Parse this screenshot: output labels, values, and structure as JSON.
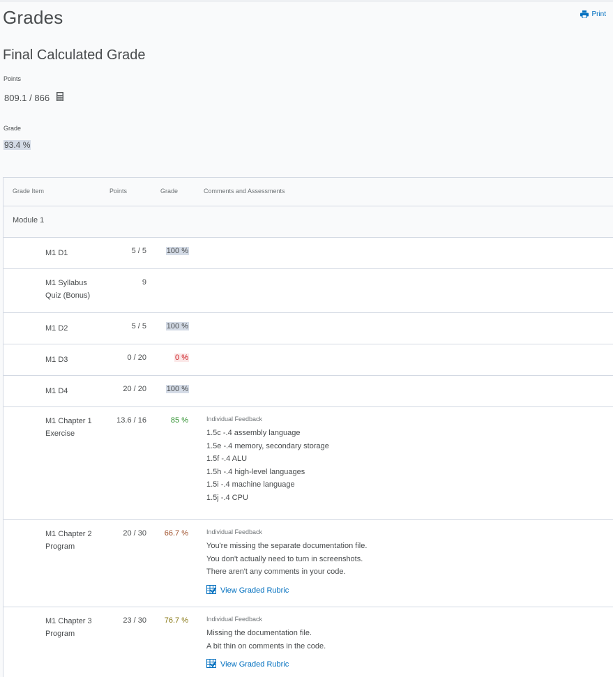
{
  "page": {
    "title": "Grades",
    "print_label": "Print"
  },
  "final": {
    "title": "Final Calculated Grade",
    "points_label": "Points",
    "points_value": "809.1 / 866",
    "grade_label": "Grade",
    "grade_value": "93.4 %"
  },
  "table": {
    "headers": {
      "item": "Grade Item",
      "points": "Points",
      "grade": "Grade",
      "comments": "Comments and Assessments"
    },
    "category": "Module 1",
    "rows": [
      {
        "name": "M1 D1",
        "points": "5 / 5",
        "grade": "100 %"
      },
      {
        "name": "M1 Syllabus Quiz (Bonus)",
        "points": "9",
        "grade": ""
      },
      {
        "name": "M1 D2",
        "points": "5 / 5",
        "grade": "100 %"
      },
      {
        "name": "M1 D3",
        "points": "0 / 20",
        "grade": "0 %"
      },
      {
        "name": "M1 D4",
        "points": "20 / 20",
        "grade": "100 %"
      },
      {
        "name": "M1 Chapter 1 Exercise",
        "points": "13.6 / 16",
        "grade": "85 %",
        "feedback_label": "Individual Feedback",
        "feedback": [
          "1.5c -.4 assembly language",
          "1.5e -.4 memory, secondary storage",
          "1.5f -.4 ALU",
          "1.5h -.4 high-level languages",
          "1.5i -.4 machine language",
          "1.5j -.4 CPU"
        ]
      },
      {
        "name": "M1 Chapter 2 Program",
        "points": "20 / 30",
        "grade": "66.7 %",
        "feedback_label": "Individual Feedback",
        "feedback": [
          "You're missing the separate documentation file.",
          "You don't actually need to turn in screenshots.",
          "There aren't any comments in your code."
        ],
        "rubric_link": "View Graded Rubric"
      },
      {
        "name": "M1 Chapter 3 Program",
        "points": "23 / 30",
        "grade": "76.7 %",
        "feedback_label": "Individual Feedback",
        "feedback": [
          "Missing the documentation file.",
          "A bit thin on comments in the code."
        ],
        "rubric_link": "View Graded Rubric"
      }
    ]
  },
  "colors": {
    "accent_link": "#006fbf",
    "grade_highlight": "#d4dbe6",
    "grade_fail": "#cd2026",
    "grade_good": "#2c8f2c"
  },
  "icons": {
    "print": "printer-icon",
    "calculator": "calculator-icon",
    "rubric": "rubric-icon"
  }
}
